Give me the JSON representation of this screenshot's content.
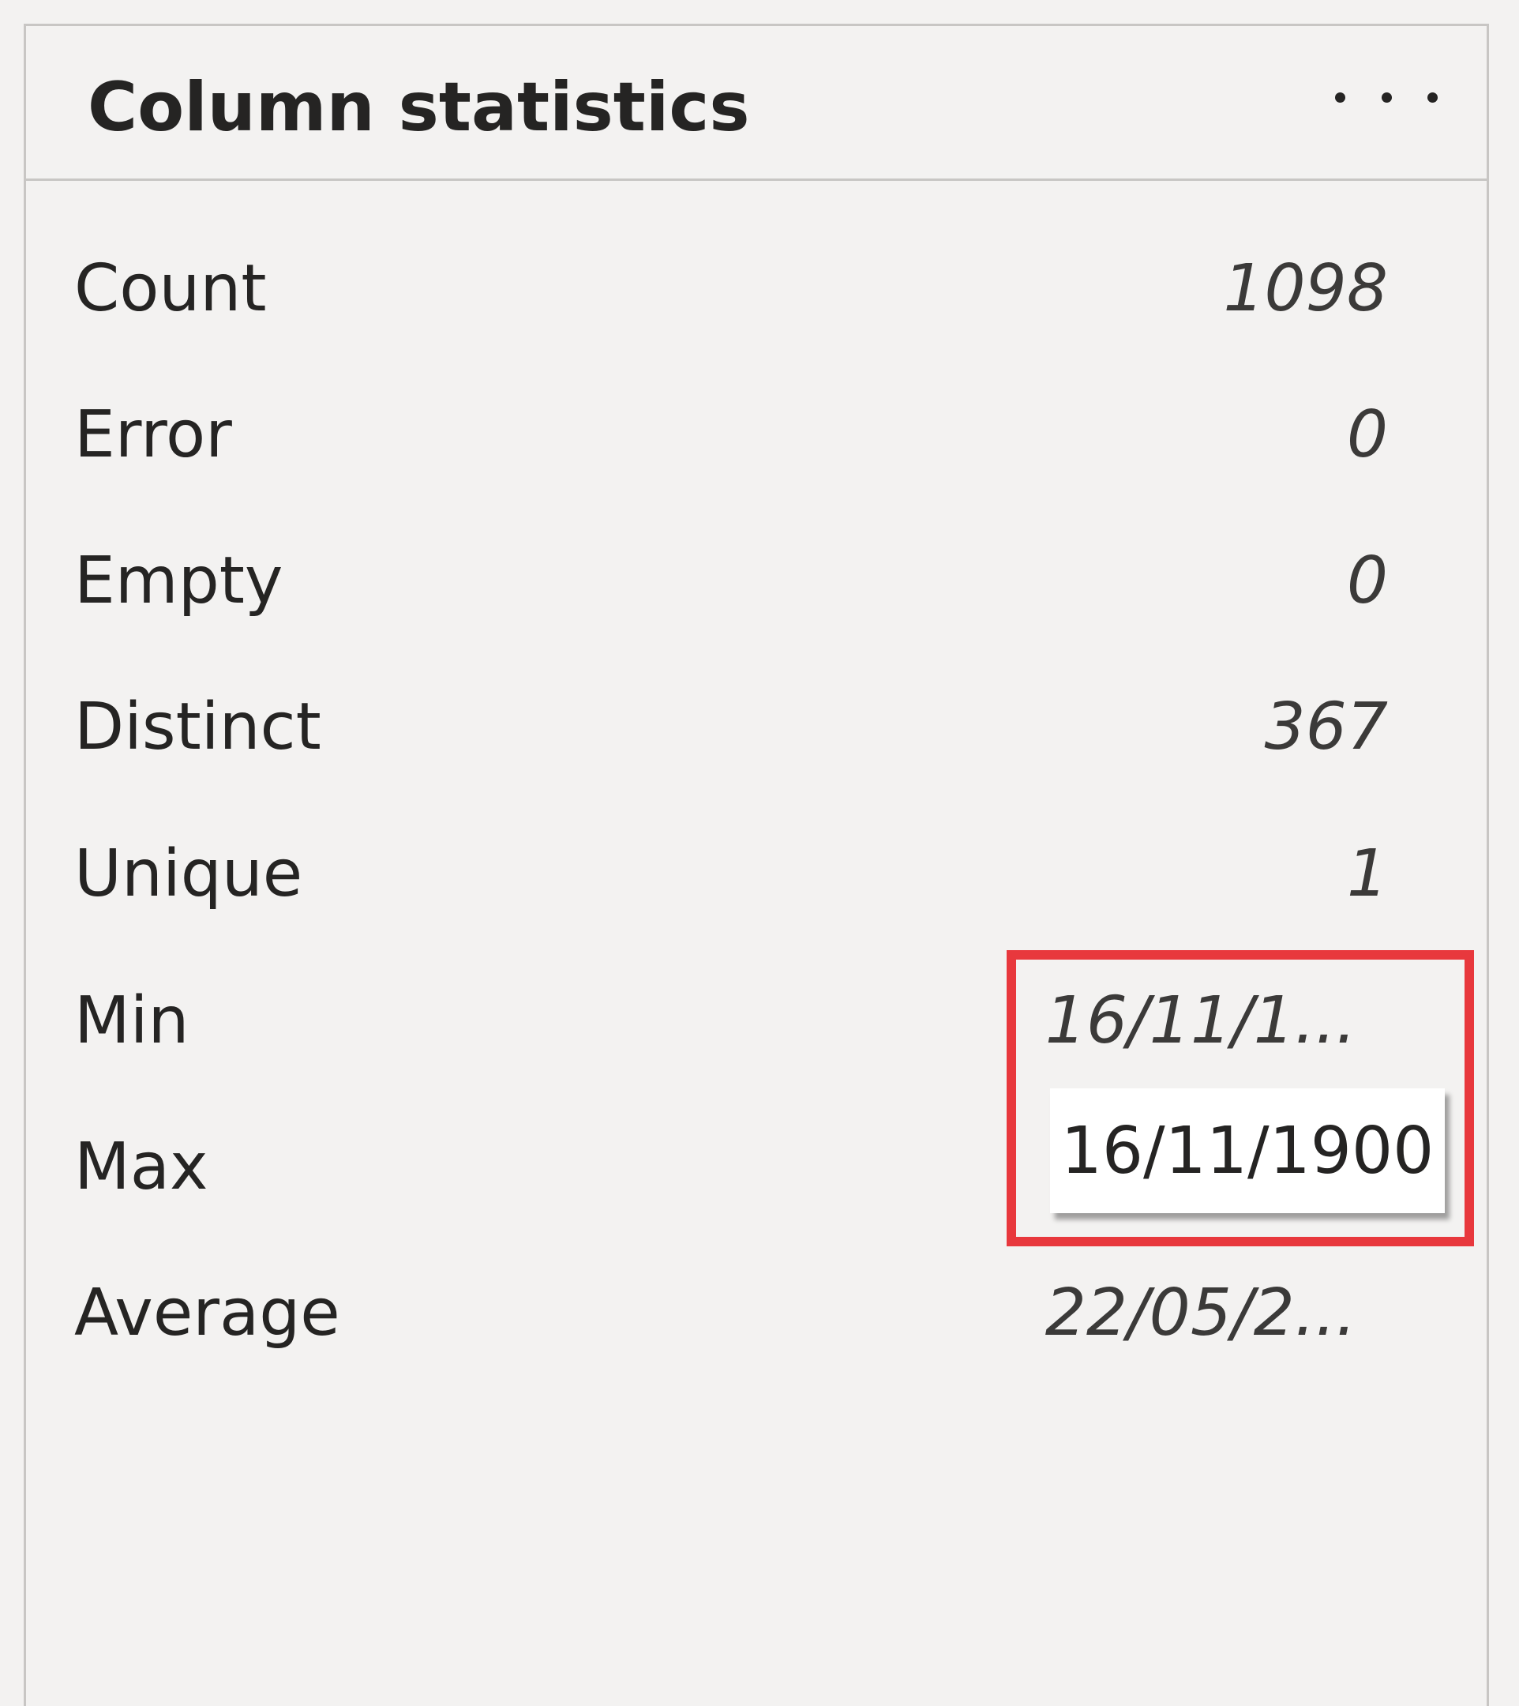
{
  "panel": {
    "title": "Column statistics"
  },
  "stats": [
    {
      "label": "Count",
      "value": "1098"
    },
    {
      "label": "Error",
      "value": "0"
    },
    {
      "label": "Empty",
      "value": "0"
    },
    {
      "label": "Distinct",
      "value": "367"
    },
    {
      "label": "Unique",
      "value": "1"
    },
    {
      "label": "Min",
      "value": "16/11/1..."
    },
    {
      "label": "Max",
      "value": ""
    },
    {
      "label": "Average",
      "value": "22/05/2..."
    }
  ],
  "tooltip": {
    "text": "16/11/1900"
  },
  "colors": {
    "highlight": "#e8383d",
    "background": "#f3f2f1"
  }
}
